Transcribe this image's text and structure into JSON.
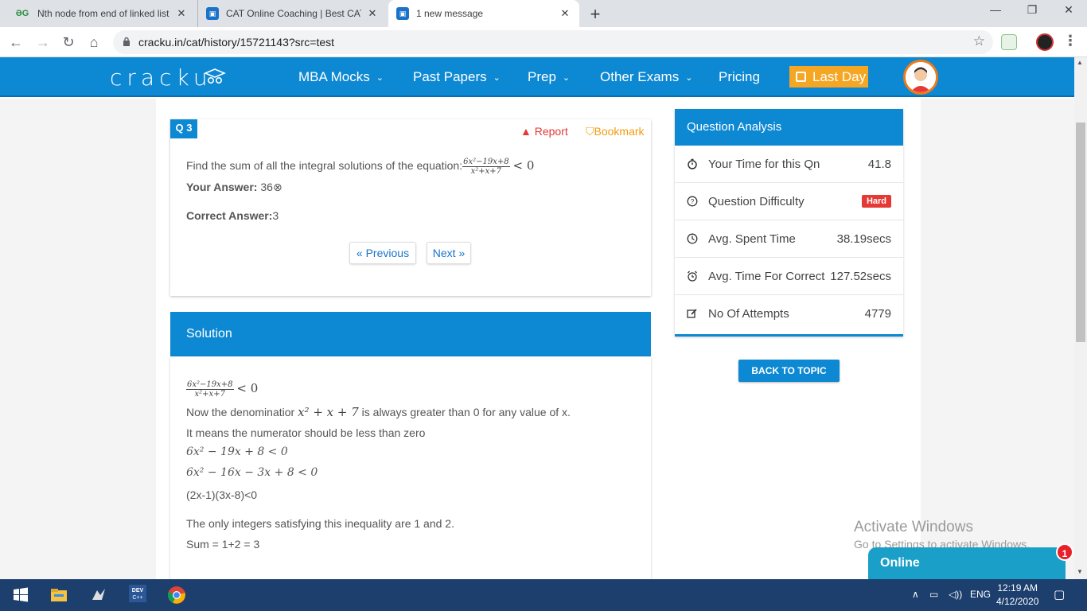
{
  "browser": {
    "tabs": [
      {
        "title": "Nth node from end of linked list |",
        "favicon": "gfg-icon"
      },
      {
        "title": "CAT Online Coaching | Best CAT C",
        "favicon": "cracku-icon"
      },
      {
        "title": "1 new message",
        "favicon": "cracku-icon",
        "active": true
      }
    ],
    "url": "cracku.in/cat/history/15721143?src=test"
  },
  "site": {
    "logo": "cracku",
    "nav": [
      "MBA Mocks",
      "Past Papers",
      "Prep",
      "Other Exams",
      "Pricing"
    ],
    "last_day": "Last Day"
  },
  "question": {
    "badge": "Q 3",
    "report": "Report",
    "bookmark": "Bookmark",
    "text": "Find the sum of all the integral solutions of the equation:",
    "frac_num": "6x²−19x+8",
    "frac_den": "x²+x+7",
    "ineq": "< 0",
    "your_answer_label": "Your Answer:",
    "your_answer": "36",
    "correct_answer_label": "Correct Answer:",
    "correct_answer": "3",
    "previous": "« Previous",
    "next": "Next »"
  },
  "solution": {
    "title": "Solution",
    "frac_num": "6x²−19x+8",
    "frac_den": "x²+x+7",
    "ineq": "< 0",
    "line1_pre": "Now the denominatior",
    "line1_math": "x² + x + 7",
    "line1_post": "is always greater than 0 for any value of x.",
    "line2": "It means the numerator should be less than zero",
    "line3": "6x² − 19x + 8 < 0",
    "line4": "6x² − 16x − 3x + 8 < 0",
    "line5": "(2x-1)(3x-8)<0",
    "line6": "The only integers satisfying this inequality are 1 and 2.",
    "line7": "Sum = 1+2 = 3"
  },
  "analysis": {
    "title": "Question Analysis",
    "rows": [
      {
        "label": "Your Time for this Qn",
        "value": "41.8",
        "icon": "stopwatch-icon"
      },
      {
        "label": "Question Difficulty",
        "value": "Hard",
        "icon": "question-circle-icon"
      },
      {
        "label": "Avg. Spent Time",
        "value": "38.19secs",
        "icon": "clock-icon"
      },
      {
        "label": "Avg. Time For Correct",
        "value": "127.52secs",
        "icon": "alarm-icon"
      },
      {
        "label": "No Of Attempts",
        "value": "4779",
        "icon": "edit-icon"
      }
    ],
    "back_to_topic": "BACK TO TOPIC"
  },
  "overlay": {
    "activate_title": "Activate Windows",
    "activate_sub": "Go to Settings to activate Windows.",
    "chat": "Online",
    "chat_count": "1"
  },
  "taskbar": {
    "lang": "ENG",
    "time": "12:19 AM",
    "date": "4/12/2020"
  },
  "colors": {
    "brand_blue": "#0d88d3",
    "accent_orange": "#f5a623",
    "danger_red": "#e53935"
  }
}
